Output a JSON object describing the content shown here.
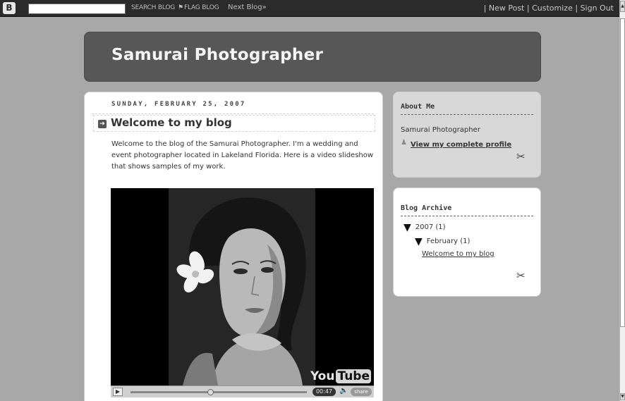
{
  "navbar": {
    "logo": "B",
    "search_blog": "SEARCH BLOG",
    "flag_blog": "FLAG BLOG",
    "next_blog": "Next Blog»",
    "new_post": "New Post",
    "customize": "Customize",
    "sign_out": "Sign Out",
    "separator": "|"
  },
  "header": {
    "title": "Samurai Photographer"
  },
  "post": {
    "date": "SUNDAY, FEBRUARY 25, 2007",
    "title": "Welcome to my blog",
    "body": "Welcome to the blog of the Samurai Photographer. I'm a wedding and event photographer located in Lakeland Florida. Here is a video slideshow that shows samples of my work."
  },
  "video": {
    "logo_you": "You",
    "logo_tube": "Tube",
    "time": "00:47",
    "share": "share",
    "progress": 0.45
  },
  "about": {
    "title": "About Me",
    "name": "Samurai Photographer",
    "profile_link": "View my complete profile"
  },
  "archive": {
    "title": "Blog Archive",
    "year": "2007 (1)",
    "month": "February (1)",
    "post_link": "Welcome to my blog"
  },
  "colors": {
    "navbar": "#2b2b2b",
    "background": "#a8a8a8",
    "header": "#575757",
    "about_widget": "#d8d8d8"
  },
  "icons": [
    "blogger-logo-icon",
    "flag-icon",
    "post-arrow-icon",
    "person-icon",
    "tools-icon",
    "triangle-down-icon",
    "play-icon",
    "volume-icon"
  ]
}
